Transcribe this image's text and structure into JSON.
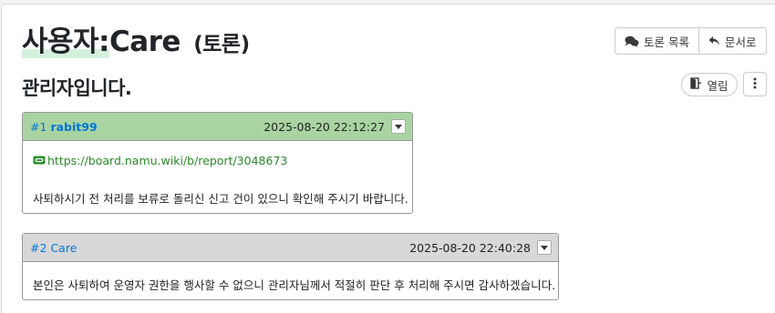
{
  "page": {
    "title_prefix": "사용자:",
    "title_name": "Care",
    "title_sub": "(토론)",
    "topic": "관리자입니다."
  },
  "actions": {
    "discussion_list": "토론 목록",
    "document": "문서로",
    "status": "열림"
  },
  "icons": {
    "discussion_list": "comments-icon",
    "document": "reply-arrow-icon",
    "status": "door-open-icon",
    "more": "vertical-ellipsis-icon",
    "dropdown": "caret-down-icon",
    "external_link": "link-icon"
  },
  "colors": {
    "first_comment_header": "#a9d4a2",
    "other_comment_header": "#d8d8d8",
    "link": "#0275d8",
    "external_link": "#2a8a2a"
  },
  "comments": [
    {
      "num": "#1",
      "author": "rabit99",
      "time": "2025-08-20 22:12:27",
      "link": "https://board.namu.wiki/b/report/3048673",
      "text": "사퇴하시기 전 처리를 보류로 돌리신 신고 건이 있으니 확인해 주시기 바랍니다."
    },
    {
      "num": "#2",
      "author": "Care",
      "time": "2025-08-20 22:40:28",
      "text": "본인은 사퇴하여 운영자 권한을 행사할 수 없으니 관리자님께서 적절히 판단 후 처리해 주시면 감사하겠습니다."
    }
  ]
}
